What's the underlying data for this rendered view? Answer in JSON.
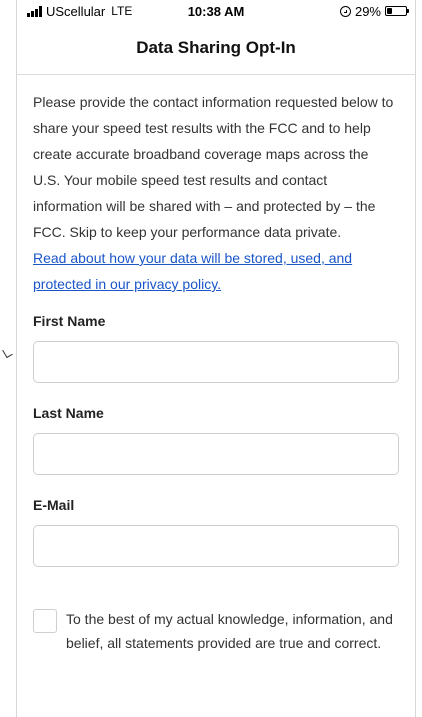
{
  "status_bar": {
    "carrier": "UScellular",
    "network": "LTE",
    "time": "10:38 AM",
    "battery_percent": "29%",
    "battery_level": 0.29,
    "signal_icon": "cellular-signal-icon",
    "orientation_lock_icon": "orientation-lock-icon",
    "battery_icon": "battery-icon"
  },
  "nav": {
    "title": "Data Sharing Opt-In"
  },
  "intro": {
    "text": "Please provide the contact information requested below to share your speed test results with the FCC and to help create accurate broadband coverage maps across the U.S. Your mobile speed test results and contact information will be shared with – and protected by – the FCC. Skip to keep your performance data private.",
    "privacy_link": "Read about how your data will be stored, used, and protected in our privacy policy."
  },
  "form": {
    "first_name": {
      "label": "First Name",
      "value": ""
    },
    "last_name": {
      "label": "Last Name",
      "value": ""
    },
    "email": {
      "label": "E-Mail",
      "value": ""
    },
    "certify": {
      "label": "To the best of my actual knowledge, information, and belief, all statements provided are true and correct.",
      "checked": false
    }
  },
  "colors": {
    "link": "#1a56c9",
    "border": "#cfcfcf",
    "divider": "#dcdcdc",
    "text": "#333333"
  }
}
